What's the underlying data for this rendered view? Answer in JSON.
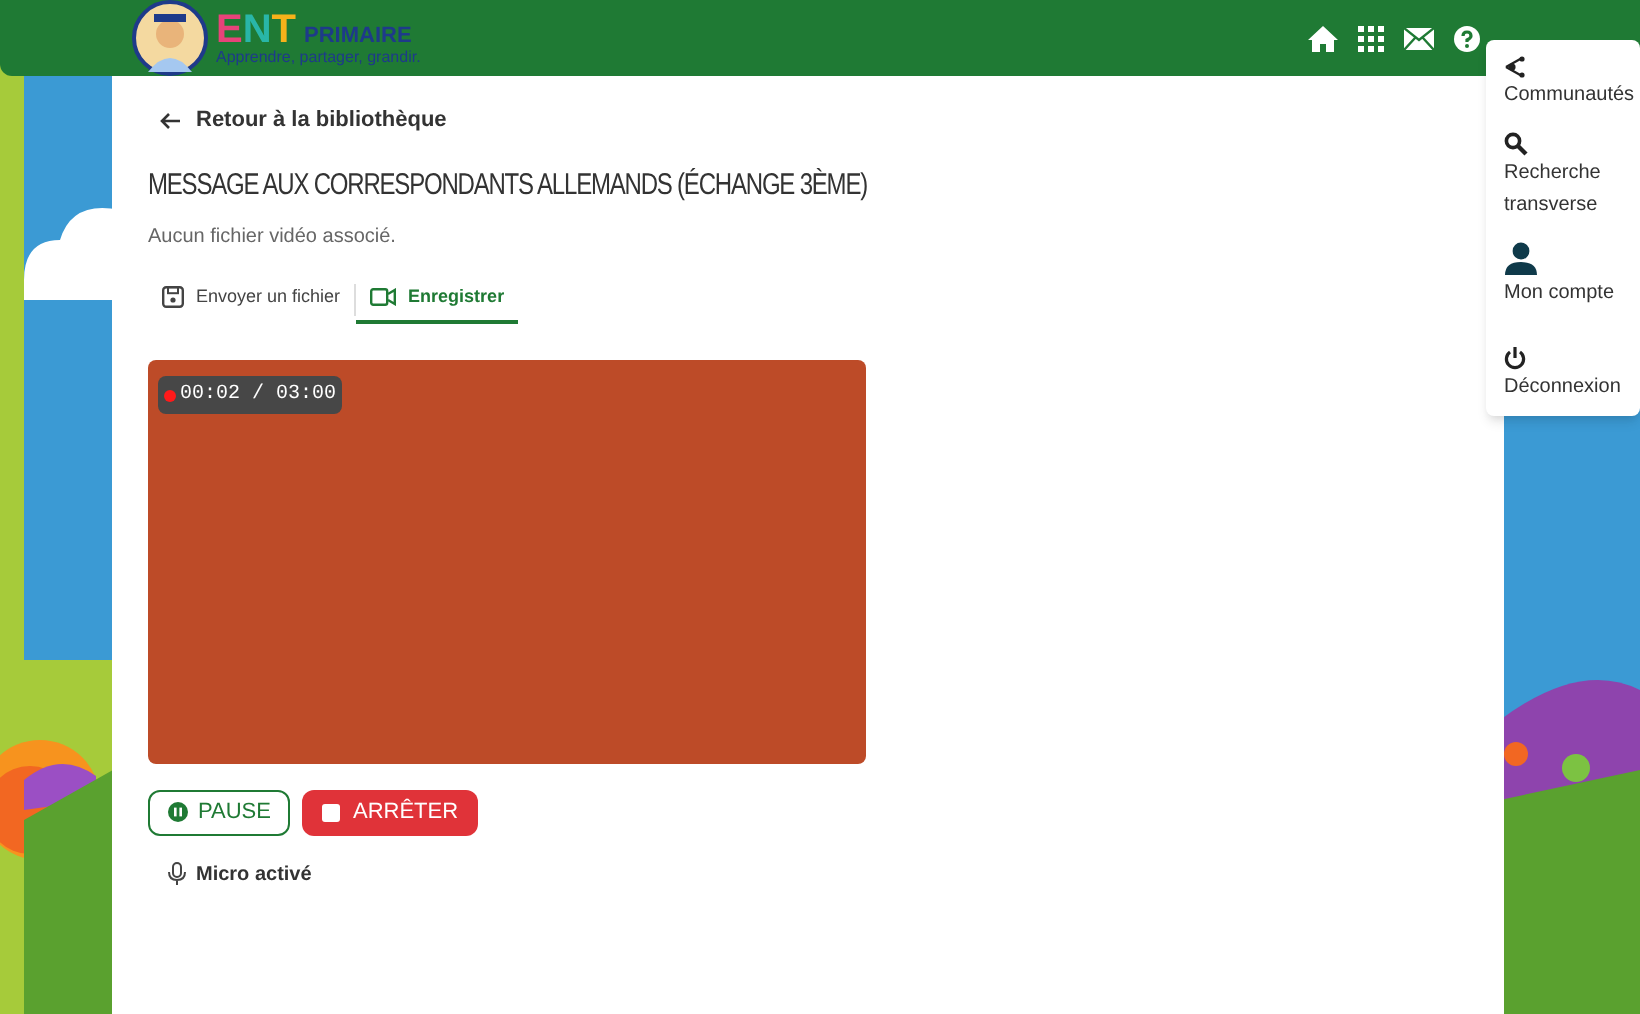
{
  "header": {
    "brand": "ENT",
    "brand_suffix": "PRIMAIRE",
    "tagline": "Apprendre, partager, grandir."
  },
  "user_menu": {
    "items": [
      {
        "label": "Communautés"
      },
      {
        "label": "Recherche transverse"
      },
      {
        "label": "Mon compte"
      },
      {
        "label": "Déconnexion"
      }
    ]
  },
  "back_link": "Retour à la bibliothèque",
  "title": "MESSAGE AUX CORRESPONDANTS ALLEMANDS (ÉCHANGE 3ÈME)",
  "subtitle": "Aucun fichier vidéo associé.",
  "tabs": [
    {
      "label": "Envoyer un fichier",
      "selected": false
    },
    {
      "label": "Enregistrer",
      "selected": true
    }
  ],
  "recorder": {
    "recording": true,
    "timer": "00:02 / 03:00"
  },
  "buttons": [
    {
      "label": "PAUSE",
      "kind": "pause"
    },
    {
      "label": "ARRÊTER",
      "kind": "stop"
    }
  ],
  "mic_status": "Micro activé"
}
